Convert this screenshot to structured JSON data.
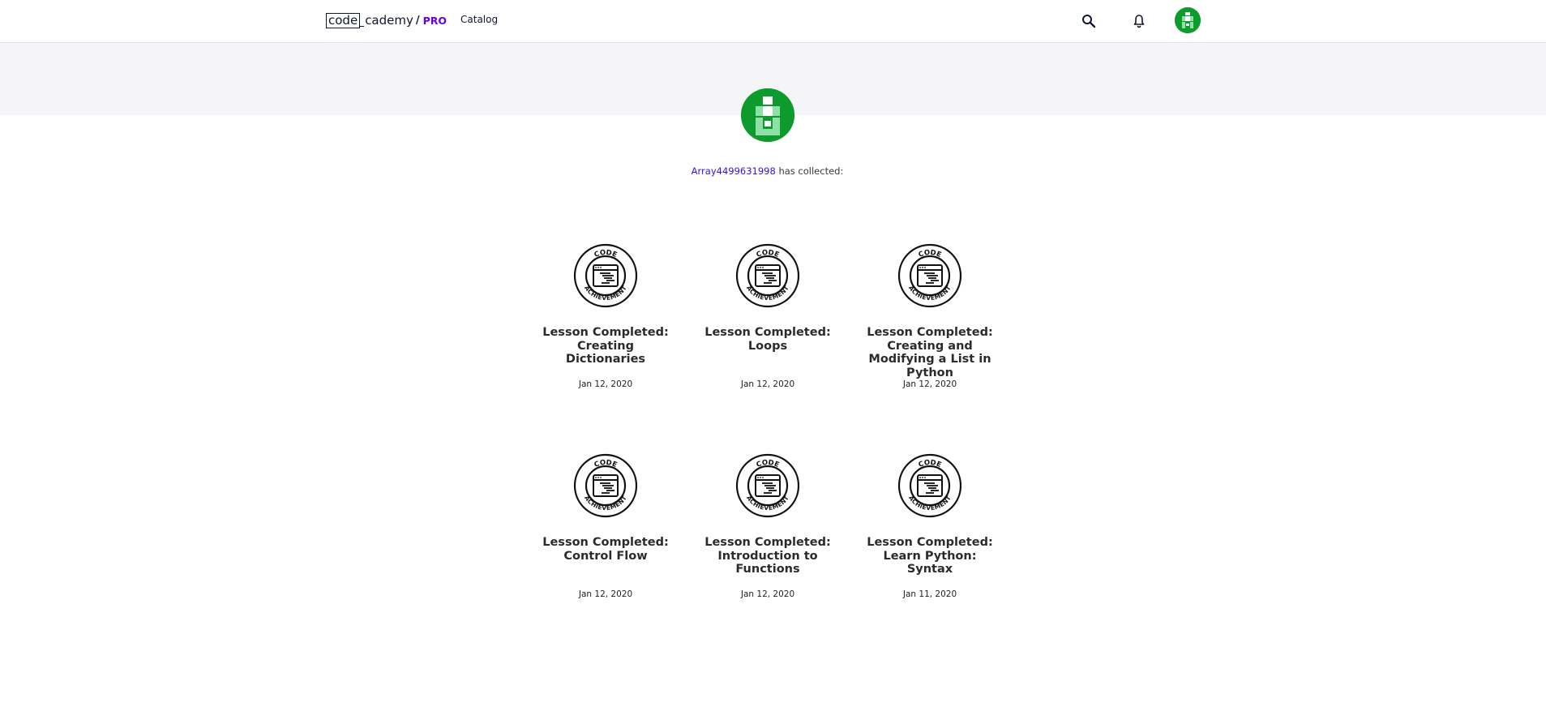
{
  "nav": {
    "logo_code": "code",
    "logo_rest": "cademy",
    "logo_slash": "/",
    "logo_pro": "PRO",
    "catalog": "Catalog",
    "icons": [
      "search-icon",
      "bell-icon",
      "avatar"
    ]
  },
  "profile": {
    "username": "Array4499631998",
    "collected_text": " has collected:"
  },
  "colors": {
    "brand_purple": "#6400e4",
    "link_blue": "#3a10e5",
    "avatar_green": "#0e9b2e",
    "avatar_light": "#8fe0a8"
  },
  "badge": {
    "top_text": "CODE",
    "bottom_text": "ACHIEVEMENT"
  },
  "achievements": [
    {
      "title": "Lesson Completed: Creating Dictionaries",
      "date": "Jan 12, 2020"
    },
    {
      "title": "Lesson Completed: Loops",
      "date": "Jan 12, 2020"
    },
    {
      "title": "Lesson Completed: Creating and Modifying a List in Python",
      "date": "Jan 12, 2020"
    },
    {
      "title": "Lesson Completed: Control Flow",
      "date": "Jan 12, 2020"
    },
    {
      "title": "Lesson Completed: Introduction to Functions",
      "date": "Jan 12, 2020"
    },
    {
      "title": "Lesson Completed: Learn Python: Syntax",
      "date": "Jan 11, 2020"
    }
  ]
}
